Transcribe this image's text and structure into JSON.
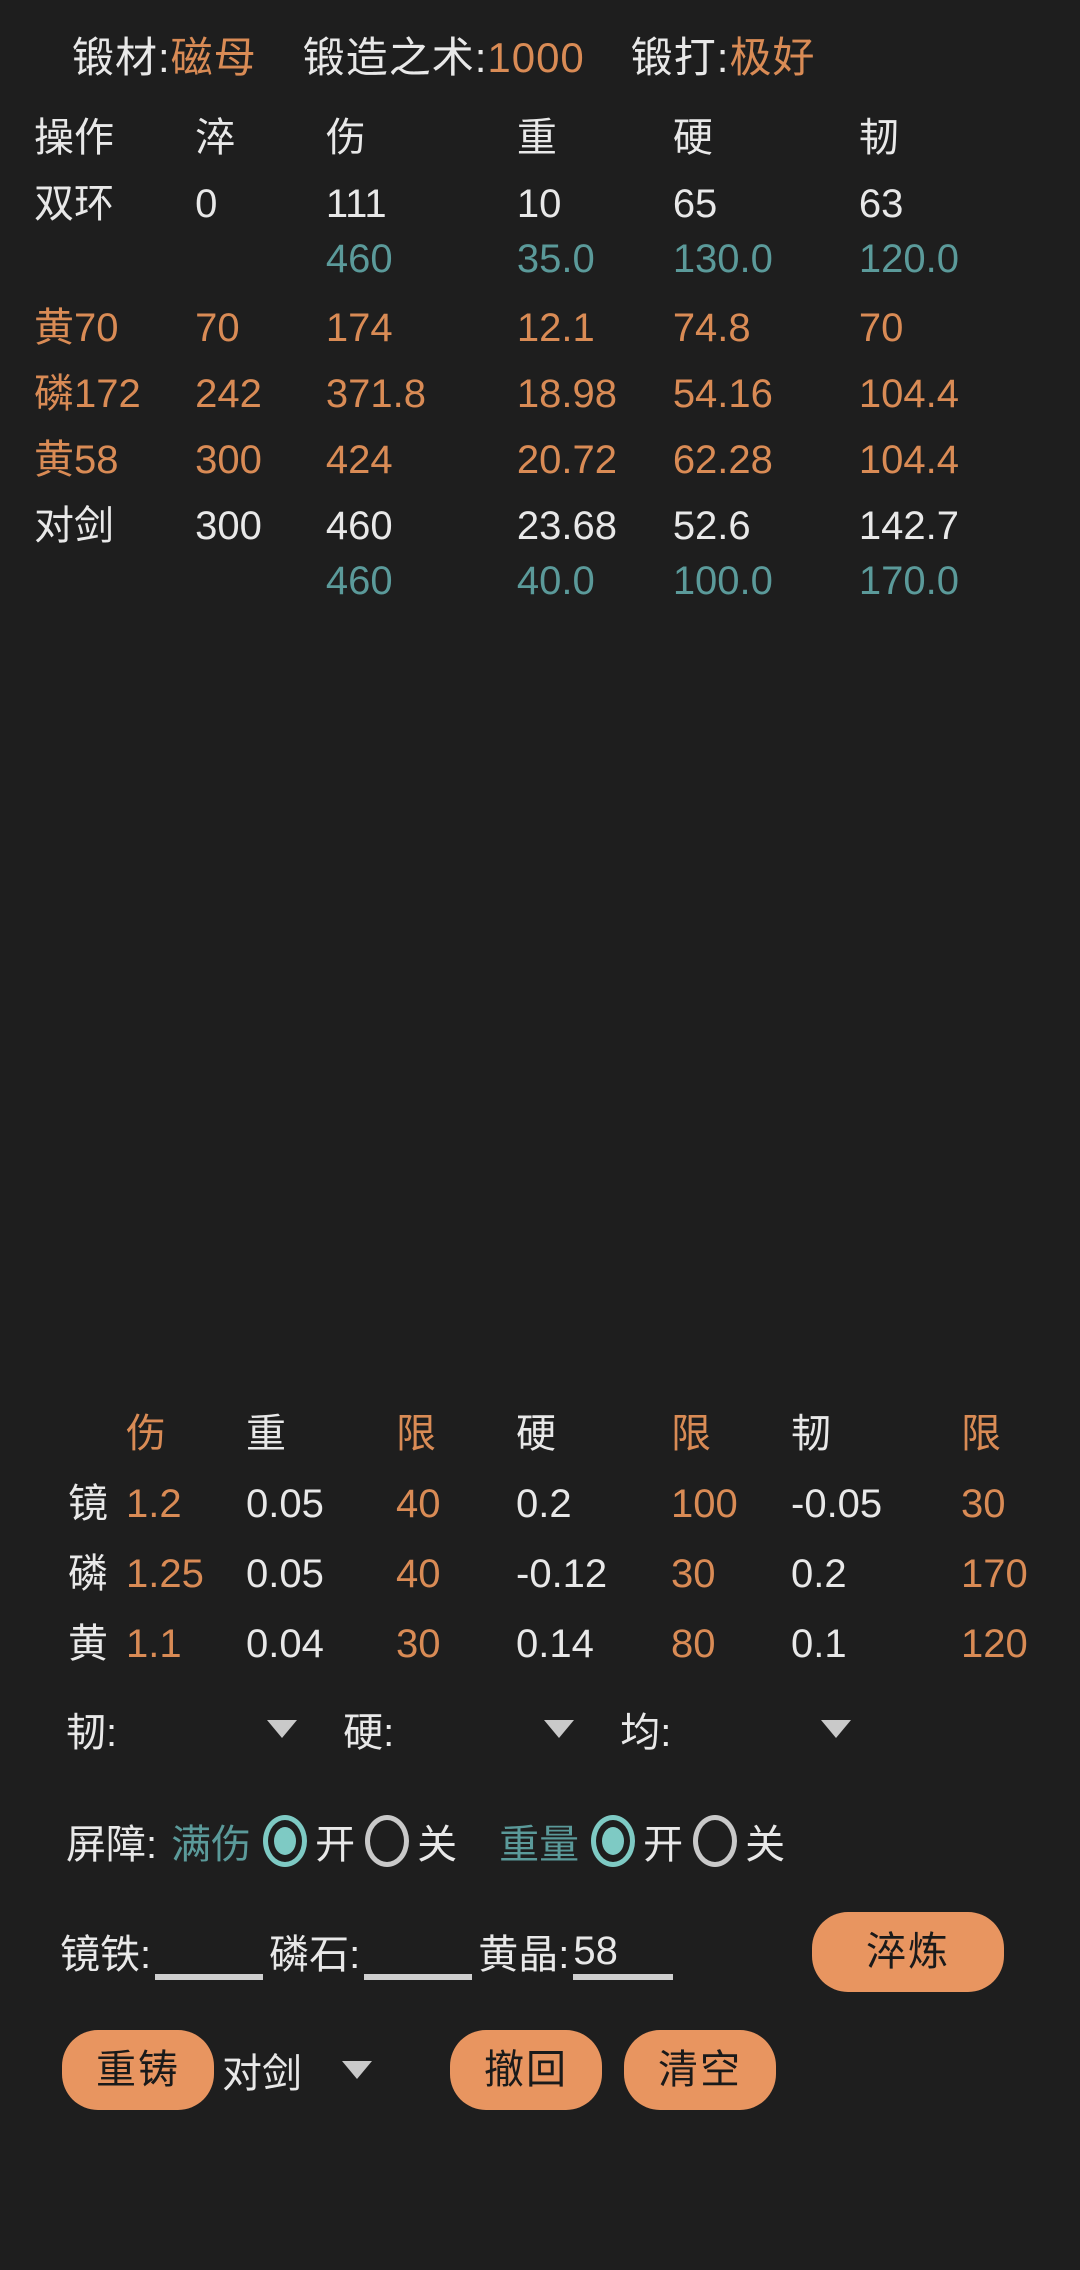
{
  "header": {
    "items": [
      {
        "label": "锻材:",
        "value": "磁母"
      },
      {
        "label": "锻造之术:",
        "value": "1000"
      },
      {
        "label": "锻打:",
        "value": "极好"
      }
    ]
  },
  "forge_table": {
    "columns": [
      "操作",
      "淬",
      "伤",
      "重",
      "硬",
      "韧"
    ],
    "rows": [
      {
        "style": "white",
        "cells": [
          "双环",
          "0",
          "111",
          "10",
          "65",
          "63"
        ]
      },
      {
        "style": "teal",
        "cells": [
          "",
          "",
          "460",
          "35.0",
          "130.0",
          "120.0"
        ]
      },
      {
        "style": "orange",
        "cells": [
          "黄70",
          "70",
          "174",
          "12.1",
          "74.8",
          "70"
        ]
      },
      {
        "style": "orange",
        "cells": [
          "磷172",
          "242",
          "371.8",
          "18.98",
          "54.16",
          "104.4"
        ]
      },
      {
        "style": "orange",
        "cells": [
          "黄58",
          "300",
          "424",
          "20.72",
          "62.28",
          "104.4"
        ]
      },
      {
        "style": "white",
        "cells": [
          "对剑",
          "300",
          "460",
          "23.68",
          "52.6",
          "142.7"
        ]
      },
      {
        "style": "teal",
        "cells": [
          "",
          "",
          "460",
          "40.0",
          "100.0",
          "170.0"
        ]
      }
    ]
  },
  "spec_table": {
    "columns": [
      "",
      "伤",
      "重",
      "限",
      "硬",
      "限",
      "韧",
      "限"
    ],
    "column_colors": [
      "white",
      "orange",
      "white",
      "orange",
      "white",
      "orange",
      "white",
      "orange"
    ],
    "rows": [
      {
        "cells": [
          "镜",
          "1.2",
          "0.05",
          "40",
          "0.2",
          "100",
          "-0.05",
          "30"
        ]
      },
      {
        "cells": [
          "磷",
          "1.25",
          "0.05",
          "40",
          "-0.12",
          "30",
          "0.2",
          "170"
        ]
      },
      {
        "cells": [
          "黄",
          "1.1",
          "0.04",
          "30",
          "0.14",
          "80",
          "0.1",
          "120"
        ]
      }
    ]
  },
  "selects": [
    {
      "label": "韧:",
      "value": ""
    },
    {
      "label": "硬:",
      "value": ""
    },
    {
      "label": "均:",
      "value": ""
    }
  ],
  "barrier": {
    "label": "屏障:",
    "groups": [
      {
        "name": "满伤",
        "on_label": "开",
        "off_label": "关",
        "selected": "on"
      },
      {
        "name": "重量",
        "on_label": "开",
        "off_label": "关",
        "selected": "on"
      }
    ]
  },
  "material_inputs": {
    "fields": [
      {
        "label": "镜铁:",
        "value": "",
        "placeholder": ""
      },
      {
        "label": "磷石:",
        "value": "",
        "placeholder": ""
      },
      {
        "label": "黄晶:",
        "value": "58",
        "placeholder": ""
      }
    ],
    "refine_button": "淬炼"
  },
  "actions": {
    "recast_button": "重铸",
    "weapon_select": "对剑",
    "undo_button": "撤回",
    "clear_button": "清空"
  },
  "colors": {
    "background": "#1e1e1e",
    "text": "#e8e8e8",
    "accent_orange": "#d98b55",
    "accent_teal": "#5b9a9a",
    "radio_teal": "#7ecac4",
    "button": "#e89560"
  },
  "icons": {
    "caret": "▼"
  }
}
